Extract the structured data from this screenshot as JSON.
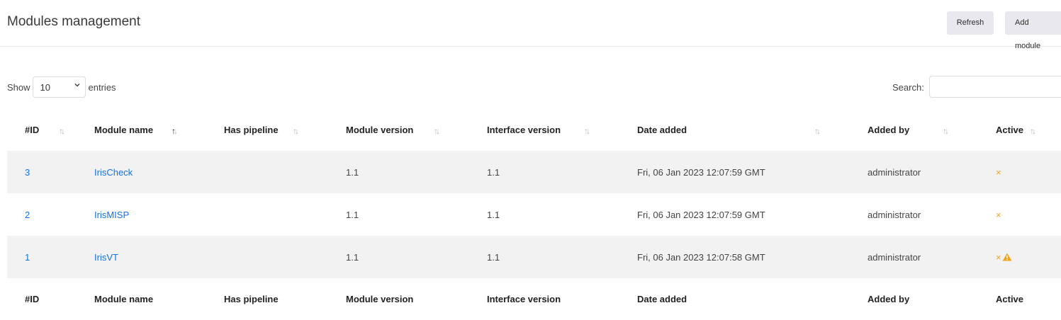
{
  "header": {
    "title": "Modules management",
    "refresh_label": "Refresh",
    "add_label": "Add module"
  },
  "length_control": {
    "show_label": "Show",
    "selected": "10",
    "entries_label": "entries"
  },
  "search": {
    "label": "Search:",
    "value": ""
  },
  "table": {
    "columns": [
      "#ID",
      "Module name",
      "Has pipeline",
      "Module version",
      "Interface version",
      "Date added",
      "Added by",
      "Active"
    ],
    "sorted_column": "Module name",
    "sorted_direction": "ascending",
    "rows": [
      {
        "id": "3",
        "name": "IrisCheck",
        "pipeline": "",
        "module_version": "1.1",
        "interface_version": "1.1",
        "date_added": "Fri, 06 Jan 2023 12:07:59 GMT",
        "added_by": "administrator",
        "active": "×",
        "warning": false
      },
      {
        "id": "2",
        "name": "IrisMISP",
        "pipeline": "",
        "module_version": "1.1",
        "interface_version": "1.1",
        "date_added": "Fri, 06 Jan 2023 12:07:59 GMT",
        "added_by": "administrator",
        "active": "×",
        "warning": false
      },
      {
        "id": "1",
        "name": "IrisVT",
        "pipeline": "",
        "module_version": "1.1",
        "interface_version": "1.1",
        "date_added": "Fri, 06 Jan 2023 12:07:58 GMT",
        "added_by": "administrator",
        "active": "×",
        "warning": true
      }
    ]
  },
  "icons": {
    "active_x": "times-icon",
    "warning": "warning-triangle-icon",
    "sort": "sort-arrows-icon",
    "select": "chevron-down-icon"
  },
  "colors": {
    "link": "#1572e8",
    "status_inactive": "#f0a31b",
    "row_stripe": "#f2f2f2",
    "button_bg": "#e8e8ee"
  }
}
